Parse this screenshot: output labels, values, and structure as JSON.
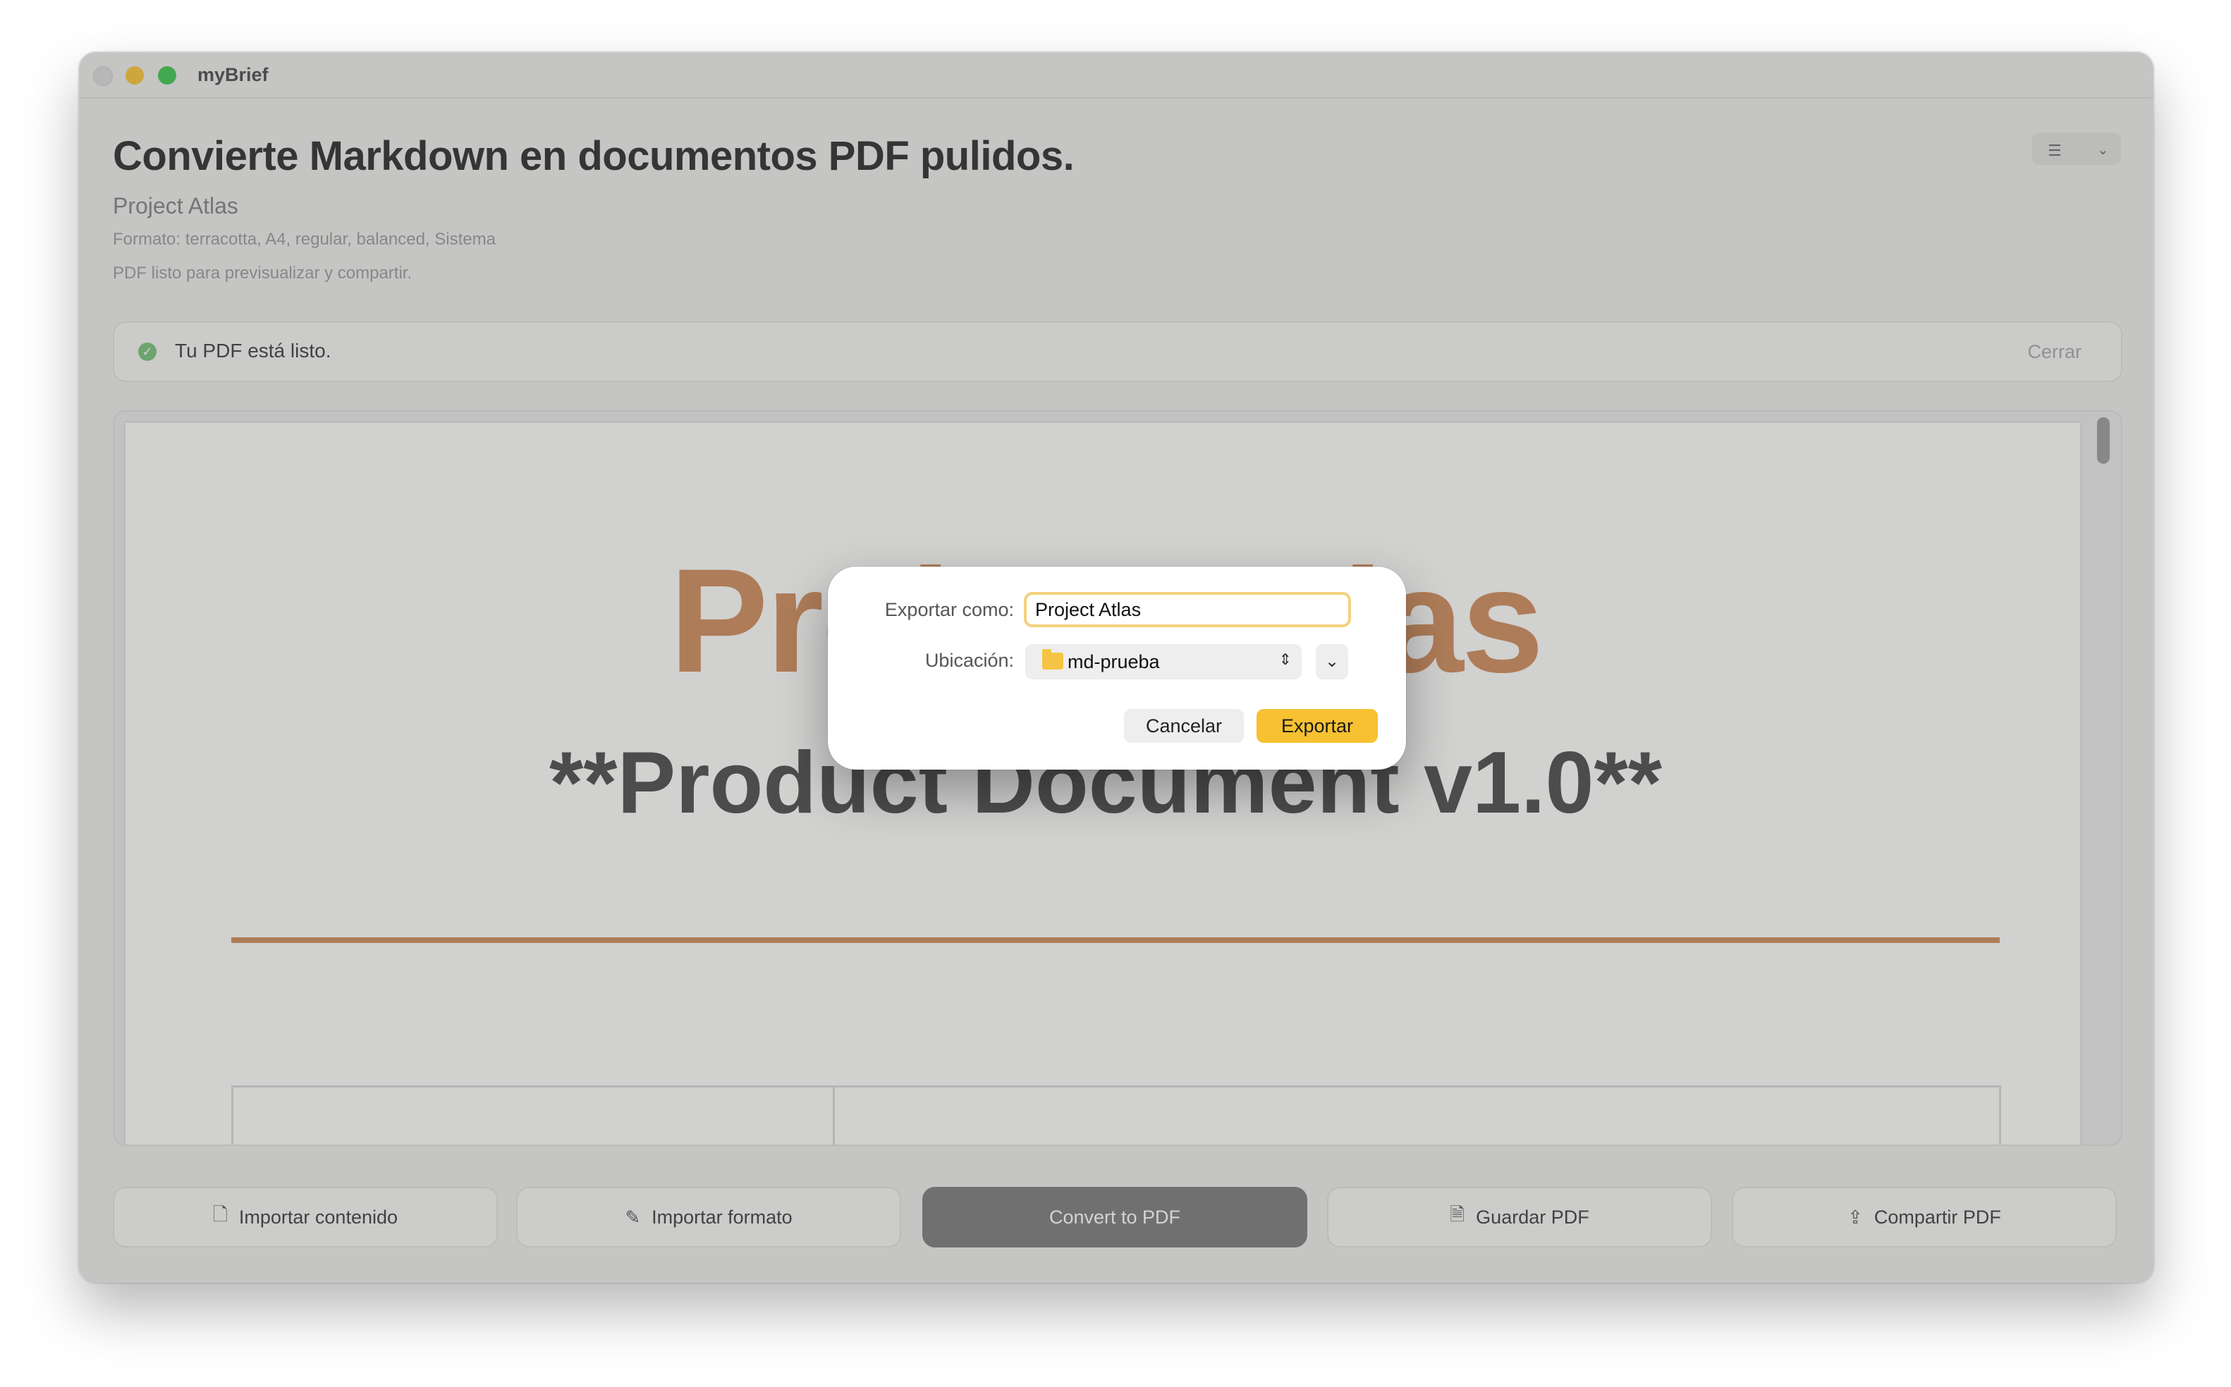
{
  "window": {
    "app_name": "myBrief"
  },
  "header": {
    "title": "Convierte Markdown en documentos PDF pulidos.",
    "project": "Project Atlas",
    "format_line": "Formato: terracotta, A4, regular, balanced, Sistema",
    "status_line": "PDF listo para previsualizar y compartir."
  },
  "banner": {
    "message": "Tu PDF está listo.",
    "close_label": "Cerrar"
  },
  "preview": {
    "doc_title": "Project Atlas",
    "doc_subtitle": "**Product Document v1.0**",
    "accent_color": "#cd8a5a"
  },
  "toolbar": {
    "import_content": "Importar contenido",
    "import_format": "Importar formato",
    "convert": "Convert to PDF",
    "save_pdf": "Guardar PDF",
    "share_pdf": "Compartir PDF"
  },
  "dialog": {
    "export_as_label": "Exportar como:",
    "export_as_value": "Project Atlas",
    "location_label": "Ubicación:",
    "location_value": "md-prueba",
    "cancel_label": "Cancelar",
    "export_label": "Exportar"
  },
  "colors": {
    "accent": "#f7c132",
    "success": "#74c079"
  }
}
